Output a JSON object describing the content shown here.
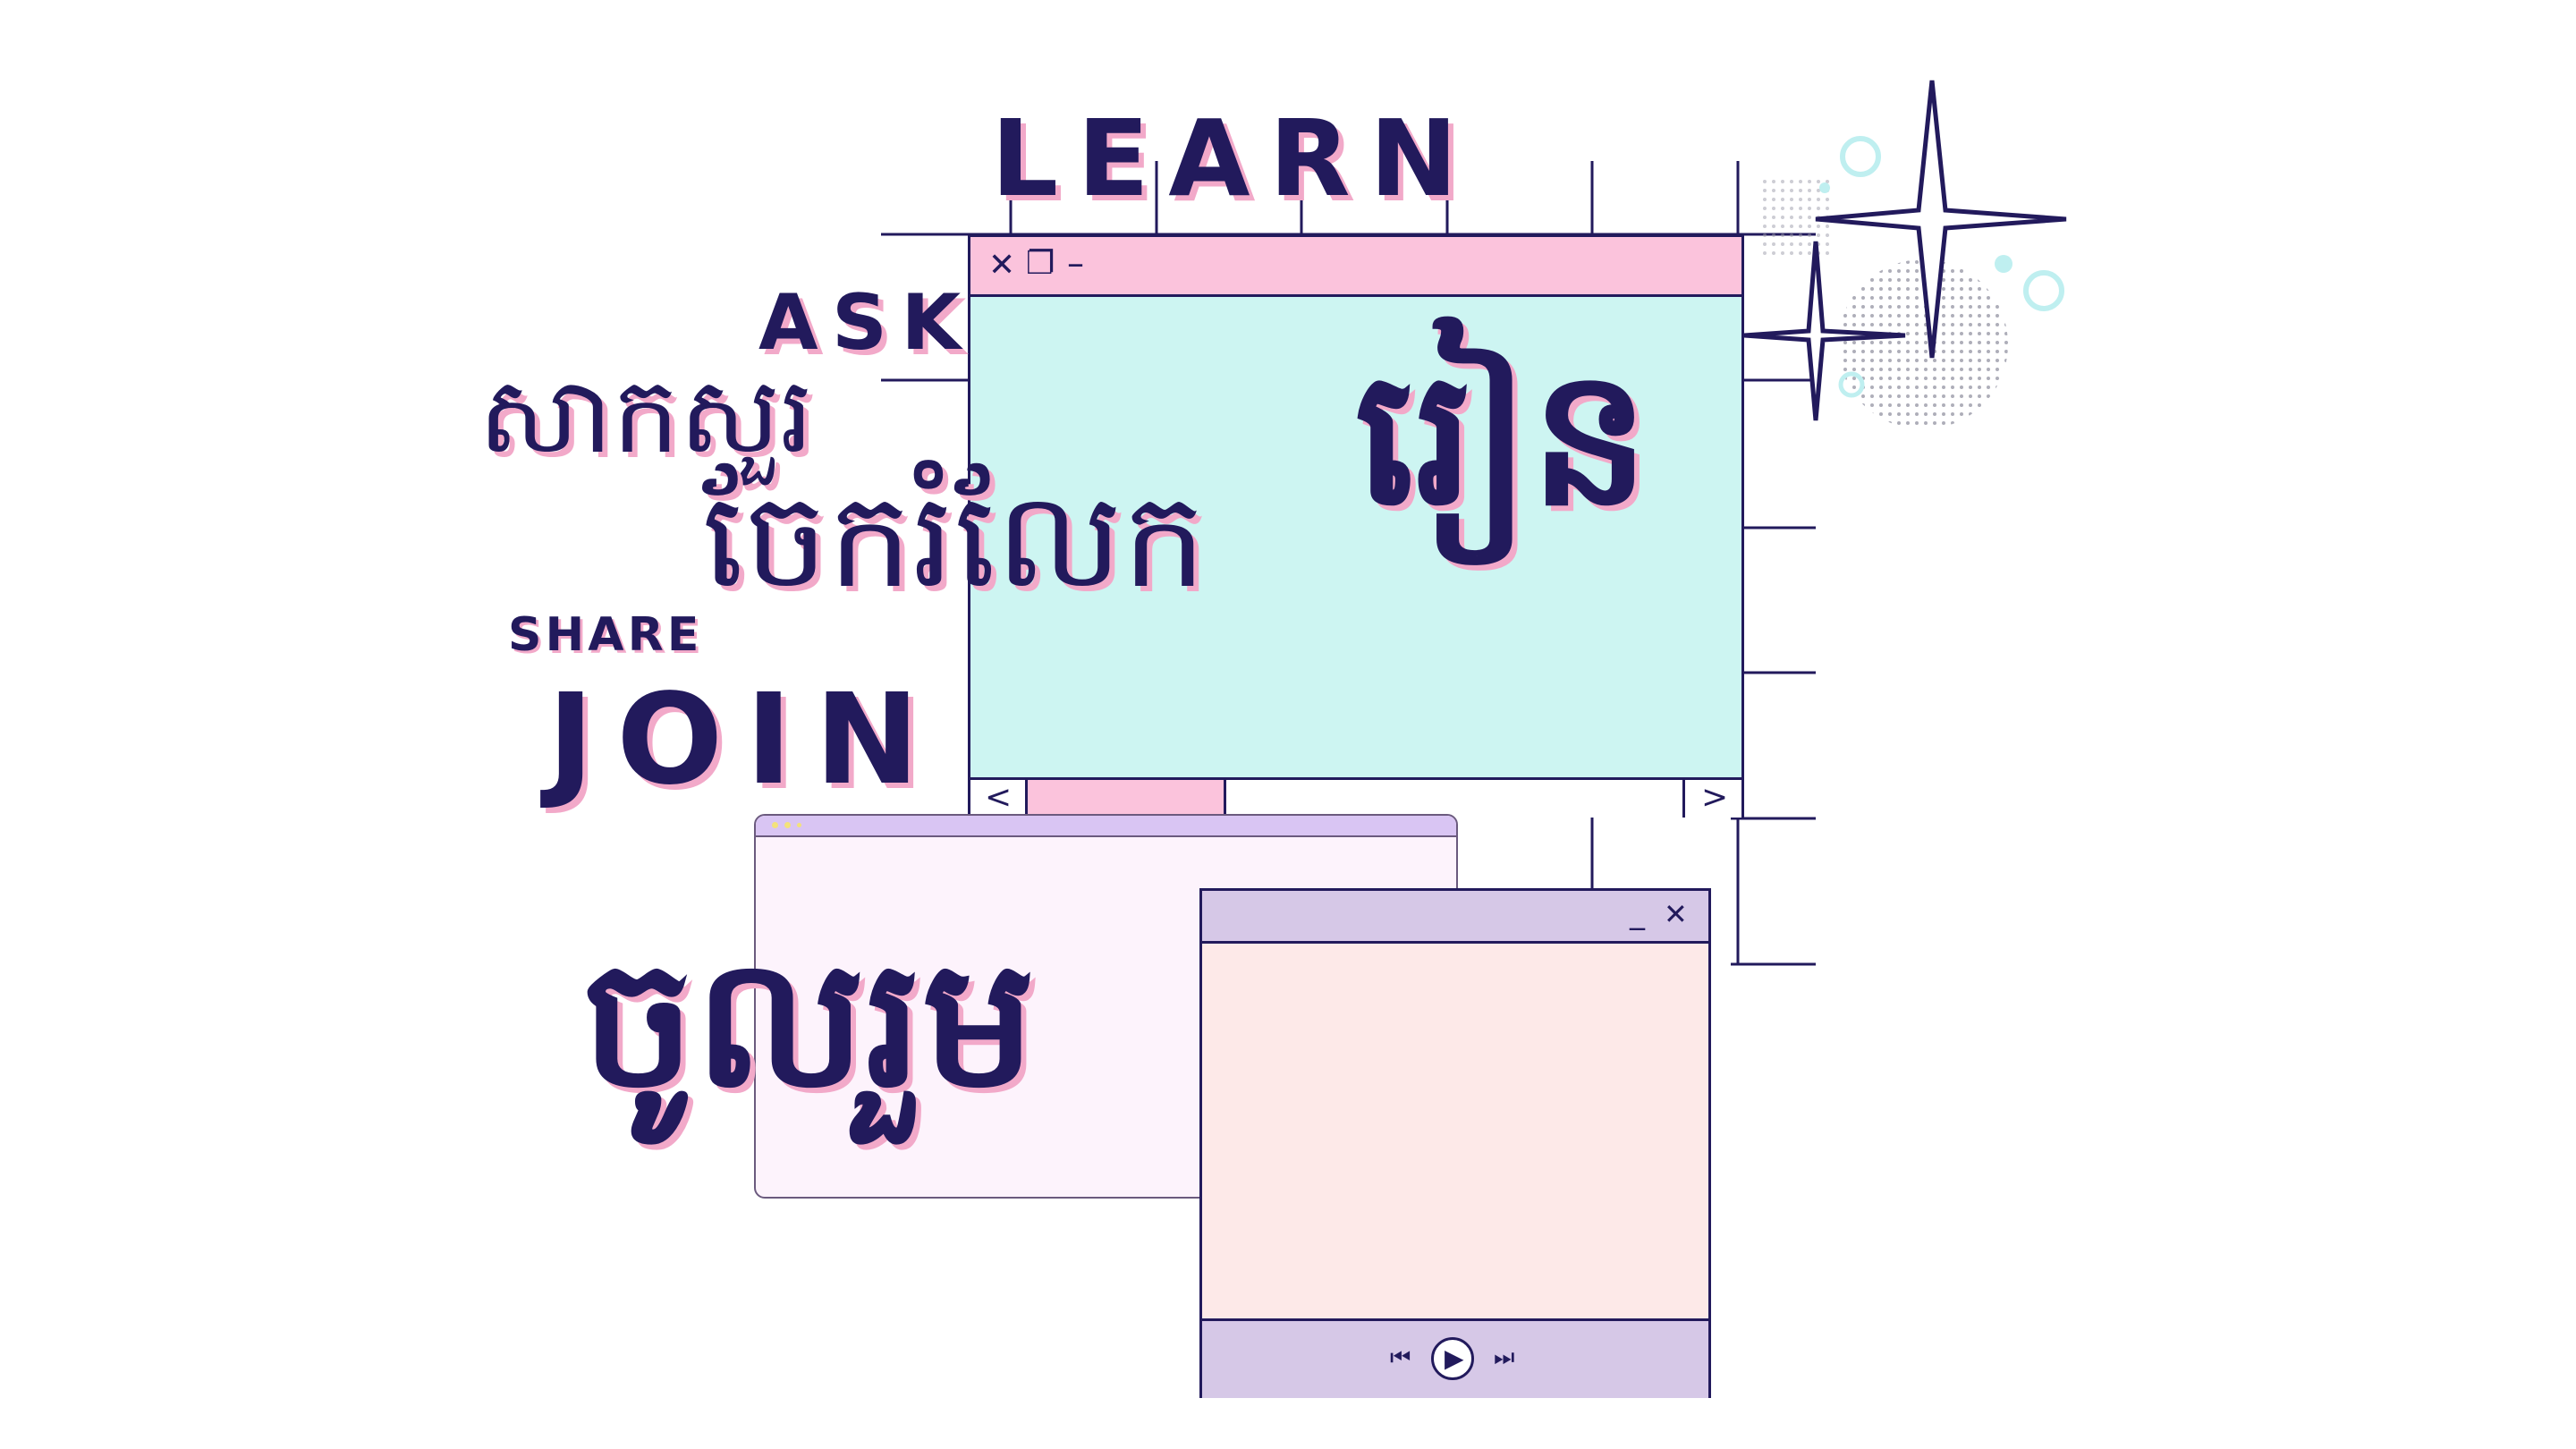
{
  "words": {
    "learn": "LEARN",
    "ask": "ASK",
    "share": "SHARE",
    "join": "JOIN",
    "km_ask": "សាកសួរ",
    "km_share": "ចែករំលែក",
    "km_learn": "រៀន",
    "km_join": "ចូលរួម"
  },
  "window_main": {
    "close_glyph": "✕",
    "restore_glyph": "❐",
    "minimize_glyph": "–",
    "scroll_left_glyph": "<",
    "scroll_right_glyph": ">"
  },
  "window_player": {
    "minimize_glyph": "_",
    "close_glyph": "✕",
    "prev_glyph": "⏮",
    "play_glyph": "▶",
    "next_glyph": "⏭"
  },
  "colors": {
    "ink": "#221a5c",
    "pink": "#fbc3dc",
    "mint": "#cdf5f2",
    "lavender": "#d6c8e7",
    "lavender_bar": "#d9c5f3",
    "blush": "#fde9e8",
    "pale_pink": "#fdf3fc",
    "shadow_pink": "#f2a9c9"
  },
  "icons": [
    "close-icon",
    "restore-icon",
    "minimize-icon",
    "chevron-left-icon",
    "chevron-right-icon",
    "skip-previous-icon",
    "play-icon",
    "skip-next-icon",
    "sparkle-icon",
    "circle-icon"
  ]
}
